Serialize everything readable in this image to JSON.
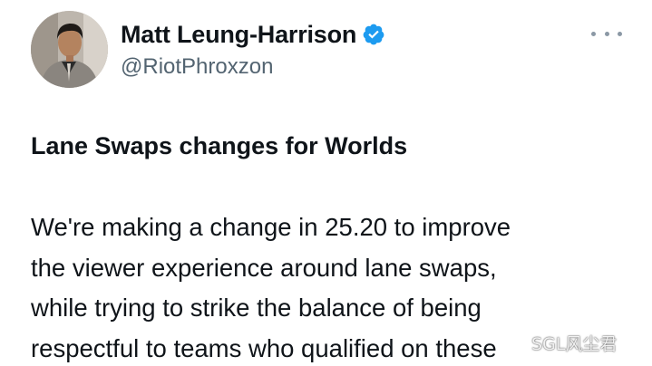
{
  "author": {
    "display_name": "Matt Leung-Harrison",
    "handle": "@RiotPhroxzon",
    "verified_color": "#1d9bf0"
  },
  "tweet": {
    "title": "Lane Swaps changes for Worlds",
    "body_lines": [
      "We're making a change in 25.20 to improve",
      "the viewer experience around lane swaps,",
      "while trying to strike the balance of being",
      "respectful to teams who qualified on these"
    ]
  },
  "watermark": "SGL风尘君"
}
